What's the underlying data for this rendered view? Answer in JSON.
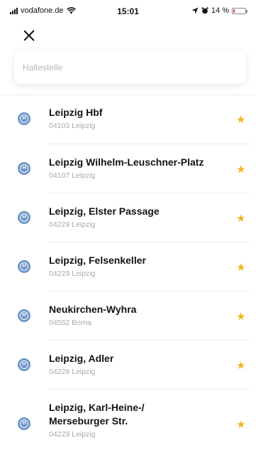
{
  "status_bar": {
    "carrier": "vodafone.de",
    "time": "15:01",
    "battery": "14 %",
    "battery_level": 0.14,
    "icons": [
      "signal-icon",
      "wifi-icon",
      "location-icon",
      "alarm-icon",
      "battery-icon"
    ]
  },
  "search": {
    "placeholder": "Haltestelle",
    "value": ""
  },
  "colors": {
    "accent_star": "#f5b324",
    "stop_icon": "#6d97c8",
    "battery_low": "#e53935"
  },
  "stops": [
    {
      "name": "Leipzig Hbf",
      "address": "04103 Leipzig",
      "favorite": true
    },
    {
      "name": "Leipzig Wilhelm-Leuschner-Platz",
      "address": "04107 Leipzig",
      "favorite": true
    },
    {
      "name": "Leipzig, Elster Passage",
      "address": "04229 Leipzig",
      "favorite": true
    },
    {
      "name": "Leipzig, Felsenkeller",
      "address": "04229 Leipzig",
      "favorite": true
    },
    {
      "name": "Neukirchen-Wyhra",
      "address": "04552 Borna",
      "favorite": true
    },
    {
      "name": "Leipzig, Adler",
      "address": "04229 Leipzig",
      "favorite": true
    },
    {
      "name_line1": "Leipzig, Karl-Heine-/",
      "name_line2": "Merseburger Str.",
      "address": "04229 Leipzig",
      "favorite": true
    }
  ],
  "icon_glyphs": {
    "stop": "H",
    "star": "★"
  }
}
